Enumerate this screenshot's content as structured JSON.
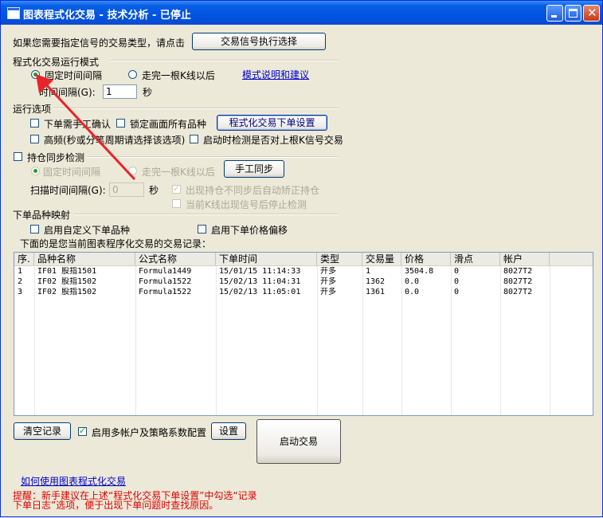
{
  "window": {
    "title": "图表程式化交易 - 技术分析 - 已停止"
  },
  "top": {
    "prompt": "如果您需要指定信号的交易类型，请点击",
    "signal_button": "交易信号执行选择"
  },
  "mode_section": {
    "heading": "程式化交易运行模式",
    "radio_fixed": "固定时间间隔",
    "radio_bar": "走完一根K线以后",
    "mode_link": "模式说明和建议",
    "interval_label": "时间间隔(G):",
    "interval_value": "1",
    "interval_unit": "秒"
  },
  "run_options": {
    "heading": "运行选项",
    "manual_confirm": "下单需手工确认",
    "lock_all": "锁定画面所有品种",
    "order_settings_button": "程式化交易下单设置",
    "high_freq": "高频(秒或分笔周期请选择该选项)",
    "check_last_signal": "启动时检测是否对上根K信号交易"
  },
  "sync_section": {
    "heading": "持仓同步检测",
    "radio_fixed": "固定时间间隔",
    "radio_bar": "走完一根K线以后",
    "manual_sync_button": "手工同步",
    "scan_label": "扫描时间间隔(G):",
    "scan_value": "0",
    "scan_unit": "秒",
    "auto_correct": "出现持仓不同步后自动矫正持仓",
    "stop_detect": "当前K线出现信号后停止检测"
  },
  "mapping_section": {
    "heading": "下单品种映射",
    "custom_symbol": "启用自定义下单品种",
    "price_offset": "启用下单价格偏移",
    "records_caption": "下面的是您当前图表程序化交易的交易记录："
  },
  "table": {
    "columns": [
      "序.",
      "品种名称",
      "公式名称",
      "下单时间",
      "类型",
      "交易量",
      "价格",
      "滑点",
      "帐户"
    ],
    "rows": [
      [
        "1",
        "IF01 股指1501",
        "Formula1449",
        "15/01/15 11:14:33",
        "开多",
        "1",
        "3504.8",
        "0",
        "8027T2"
      ],
      [
        "2",
        "IF02 股指1502",
        "Formula1522",
        "15/02/13 11:04:31",
        "开多",
        "1362",
        "0.0",
        "0",
        "8027T2"
      ],
      [
        "3",
        "IF02 股指1502",
        "Formula1522",
        "15/02/13 11:05:01",
        "开多",
        "1361",
        "0.0",
        "0",
        "8027T2"
      ]
    ]
  },
  "bottom": {
    "clear_button": "清空记录",
    "multi_account": "启用多帐户及策略系数配置",
    "settings_button": "设置",
    "start_button": "启动交易",
    "help_link": "如何使用图表程式化交易",
    "hint_line1": "提醒：新手建议在上述“程式化交易下单设置”中勾选“记录",
    "hint_line2": "下单日志”选项，便于出现下单问题时查找原因。"
  },
  "colors": {
    "accent": "#0054E3",
    "hint": "#E00000",
    "arrow": "#E8242A"
  }
}
